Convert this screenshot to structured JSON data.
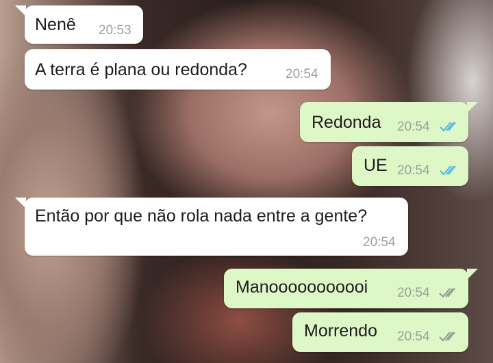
{
  "messages": [
    {
      "text": "Nenê",
      "time": "20:53",
      "direction": "incoming"
    },
    {
      "text": "A terra é plana ou redonda?",
      "time": "20:54",
      "direction": "incoming"
    },
    {
      "text": "Redonda",
      "time": "20:54",
      "direction": "outgoing",
      "status": "read"
    },
    {
      "text": "UE",
      "time": "20:54",
      "direction": "outgoing",
      "status": "read"
    },
    {
      "text": "Então por que não rola nada entre a gente?",
      "time": "20:54",
      "direction": "incoming"
    },
    {
      "text": "Manooooooooooi",
      "time": "20:54",
      "direction": "outgoing",
      "status": "delivered"
    },
    {
      "text": "Morrendo",
      "time": "20:54",
      "direction": "outgoing",
      "status": "delivered"
    }
  ],
  "colors": {
    "incoming_bubble": "#ffffff",
    "outgoing_bubble": "#ddf7c6",
    "timestamp": "#9aa19a",
    "read_ticks": "#4fb6ec",
    "delivered_ticks": "#8f9a90"
  },
  "icons": {
    "read": "double-check-blue-icon",
    "delivered": "double-check-gray-icon"
  }
}
